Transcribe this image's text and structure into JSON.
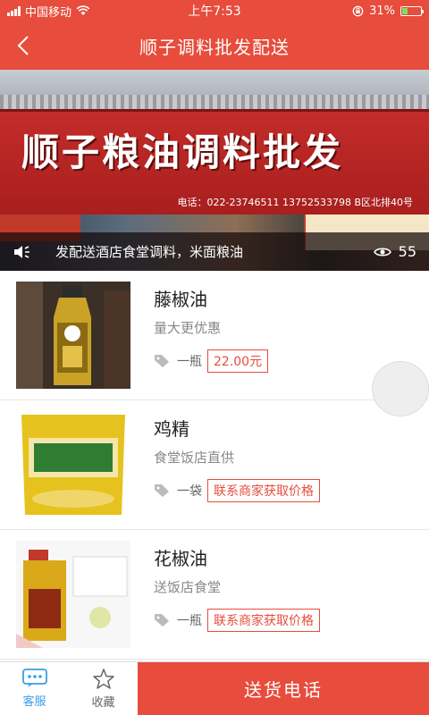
{
  "status_bar": {
    "carrier": "中国移动",
    "time": "上午7:53",
    "battery": "31%",
    "battery_level": 0.31
  },
  "header": {
    "title": "顺子调料批发配送"
  },
  "banner": {
    "sign_text": "顺子粮油调料批发",
    "sign_phone": "电话：022-23746511  13752533798 B区北排40号",
    "notice": "发配送酒店食堂调料，米面粮油",
    "view_count": "55"
  },
  "products": [
    {
      "name": "藤椒油",
      "desc": "量大更优惠",
      "unit": "一瓶",
      "price": "22.00元"
    },
    {
      "name": "鸡精",
      "desc": "食堂饭店直供",
      "unit": "一袋",
      "price": "联系商家获取价格"
    },
    {
      "name": "花椒油",
      "desc": "送饭店食堂",
      "unit": "一瓶",
      "price": "联系商家获取价格"
    }
  ],
  "bottom_bar": {
    "service_label": "客服",
    "favorite_label": "收藏",
    "call_label": "送货电话"
  },
  "colors": {
    "accent": "#e74c3c",
    "active_tab": "#3a9ee6"
  },
  "icons": [
    "back-icon",
    "speaker-icon",
    "eye-icon",
    "tag-icon",
    "chat-icon",
    "star-icon",
    "wifi-icon",
    "battery-icon"
  ]
}
